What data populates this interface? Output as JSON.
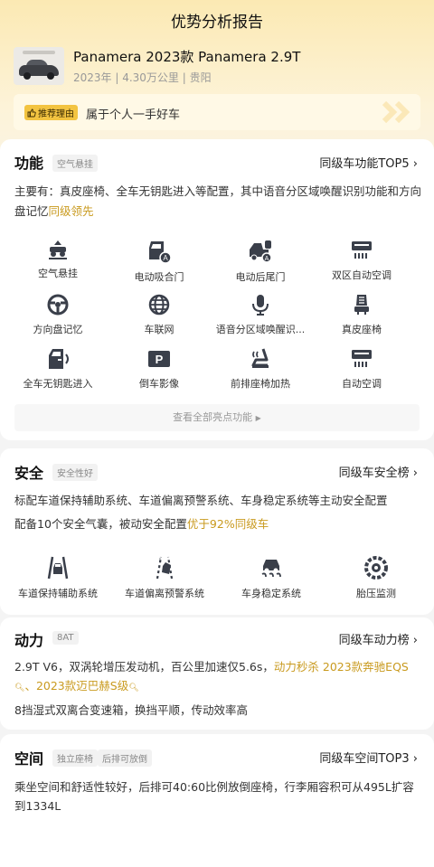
{
  "header": {
    "title": "优势分析报告"
  },
  "car": {
    "name": "Panamera 2023款 Panamera 2.9T",
    "meta": "2023年 | 4.30万公里 | 贵阳"
  },
  "reason": {
    "badge": "推荐理由",
    "text": "属于个人一手好车"
  },
  "features": {
    "title": "功能",
    "tag": "空气悬挂",
    "link": "同级车功能TOP5",
    "desc_prefix": "主要有：真皮座椅、全车无钥匙进入等配置，其中语音分区域唤醒识别功能和方向盘记忆",
    "desc_highlight": "同级领先",
    "items": [
      {
        "label": "空气悬挂",
        "icon": "air-suspension-icon"
      },
      {
        "label": "电动吸合门",
        "icon": "soft-close-door-icon"
      },
      {
        "label": "电动后尾门",
        "icon": "power-tailgate-icon"
      },
      {
        "label": "双区自动空调",
        "icon": "dual-zone-ac-icon"
      },
      {
        "label": "方向盘记忆",
        "icon": "steering-memory-icon"
      },
      {
        "label": "车联网",
        "icon": "connected-car-icon"
      },
      {
        "label": "语音分区域唤醒识...",
        "icon": "voice-microphone-icon"
      },
      {
        "label": "真皮座椅",
        "icon": "leather-seat-icon"
      },
      {
        "label": "全车无钥匙进入",
        "icon": "keyless-entry-icon"
      },
      {
        "label": "倒车影像",
        "icon": "reverse-camera-icon"
      },
      {
        "label": "前排座椅加热",
        "icon": "seat-heating-icon"
      },
      {
        "label": "自动空调",
        "icon": "auto-ac-icon"
      }
    ],
    "more": "查看全部亮点功能"
  },
  "safety": {
    "title": "安全",
    "tag": "安全性好",
    "link": "同级车安全榜",
    "desc_line1": "标配车道保持辅助系统、车道偏离预警系统、车身稳定系统等主动安全配置",
    "desc_line2_prefix": "配备10个安全气囊，被动安全配置",
    "desc_line2_highlight": "优于92%同级车",
    "items": [
      {
        "label": "车道保持辅助系统",
        "icon": "lane-keep-icon"
      },
      {
        "label": "车道偏离预警系统",
        "icon": "lane-departure-icon"
      },
      {
        "label": "车身稳定系统",
        "icon": "stability-control-icon"
      },
      {
        "label": "胎压监测",
        "icon": "tire-pressure-icon"
      }
    ]
  },
  "power": {
    "title": "动力",
    "tag": "8AT",
    "link": "同级车动力榜",
    "desc_prefix": "2.9T V6，双涡轮增压发动机，百公里加速仅5.6s，",
    "desc_highlight1": "动力秒杀 2023款奔驰EQS",
    "desc_sep": "、",
    "desc_highlight2": "2023款迈巴赫S级",
    "desc_line2": "8挡湿式双离合变速箱，换挡平顺，传动效率高"
  },
  "space": {
    "title": "空间",
    "tag1": "独立座椅",
    "tag2": "后排可放倒",
    "link": "同级车空间TOP3",
    "desc": "乘坐空间和舒适性较好，后排可40:60比例放倒座椅，行李厢容积可从495L扩容到1334L"
  },
  "colors": {
    "accent": "#c99a1e",
    "badge": "#f3c441",
    "top_bg": "#fbe9b3"
  }
}
